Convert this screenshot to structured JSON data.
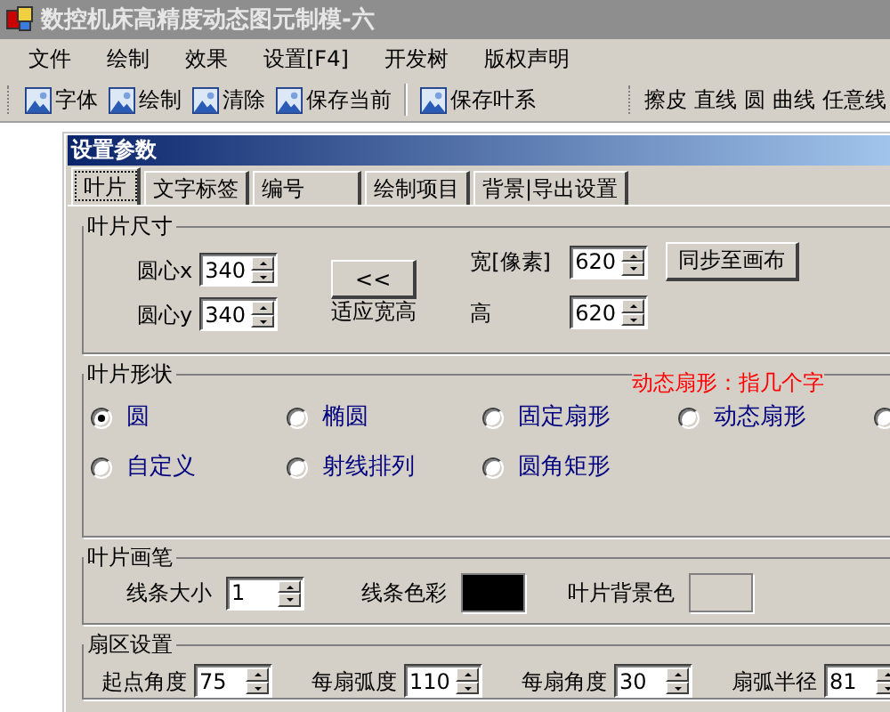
{
  "window": {
    "title": "数控机床高精度动态图元制模-六"
  },
  "menu": [
    "文件",
    "绘制",
    "效果",
    "设置[F4]",
    "开发树",
    "版权声明"
  ],
  "toolbar": {
    "buttons": [
      "字体",
      "绘制",
      "清除",
      "保存当前",
      "保存叶系"
    ],
    "tools": [
      "擦皮",
      "直线",
      "圆",
      "曲线",
      "任意线"
    ]
  },
  "dialog": {
    "title": "设置参数",
    "tabs": [
      {
        "label": "叶片",
        "selected": true
      },
      {
        "label": "文字标签",
        "selected": false
      },
      {
        "label": "编号",
        "selected": false
      },
      {
        "label": "绘制项目",
        "selected": false
      },
      {
        "label": "背景|导出设置",
        "selected": false
      }
    ],
    "size_group": {
      "title": "叶片尺寸",
      "center_x": {
        "label": "圆心x",
        "value": "340"
      },
      "center_y": {
        "label": "圆心y",
        "value": "340"
      },
      "fit_button": "<<",
      "fit_label": "适应宽高",
      "width": {
        "label": "宽[像素]",
        "value": "620"
      },
      "height": {
        "label": "高",
        "value": "620"
      },
      "sync_button": "同步至画布"
    },
    "shape_group": {
      "title": "叶片形状",
      "note": "动态扇形：指几个字",
      "options": [
        {
          "label": "圆",
          "selected": true
        },
        {
          "label": "椭圆",
          "selected": false
        },
        {
          "label": "固定扇形",
          "selected": false
        },
        {
          "label": "动态扇形",
          "selected": false
        },
        {
          "selected": false
        },
        {
          "label": "自定义",
          "selected": false
        },
        {
          "label": "射线排列",
          "selected": false
        },
        {
          "label": "圆角矩形",
          "selected": false
        }
      ]
    },
    "pen_group": {
      "title": "叶片画笔",
      "line_size": {
        "label": "线条大小",
        "value": "1"
      },
      "line_color": {
        "label": "线条色彩",
        "color": "#000000"
      },
      "background_color": {
        "label": "叶片背景色"
      }
    },
    "sector_group": {
      "title": "扇区设置",
      "fields": [
        {
          "label": "起点角度",
          "value": "75"
        },
        {
          "label": "每扇弧度",
          "value": "110"
        },
        {
          "label": "每扇角度",
          "value": "30"
        },
        {
          "label": "扇弧半径",
          "value": "81"
        }
      ]
    }
  }
}
